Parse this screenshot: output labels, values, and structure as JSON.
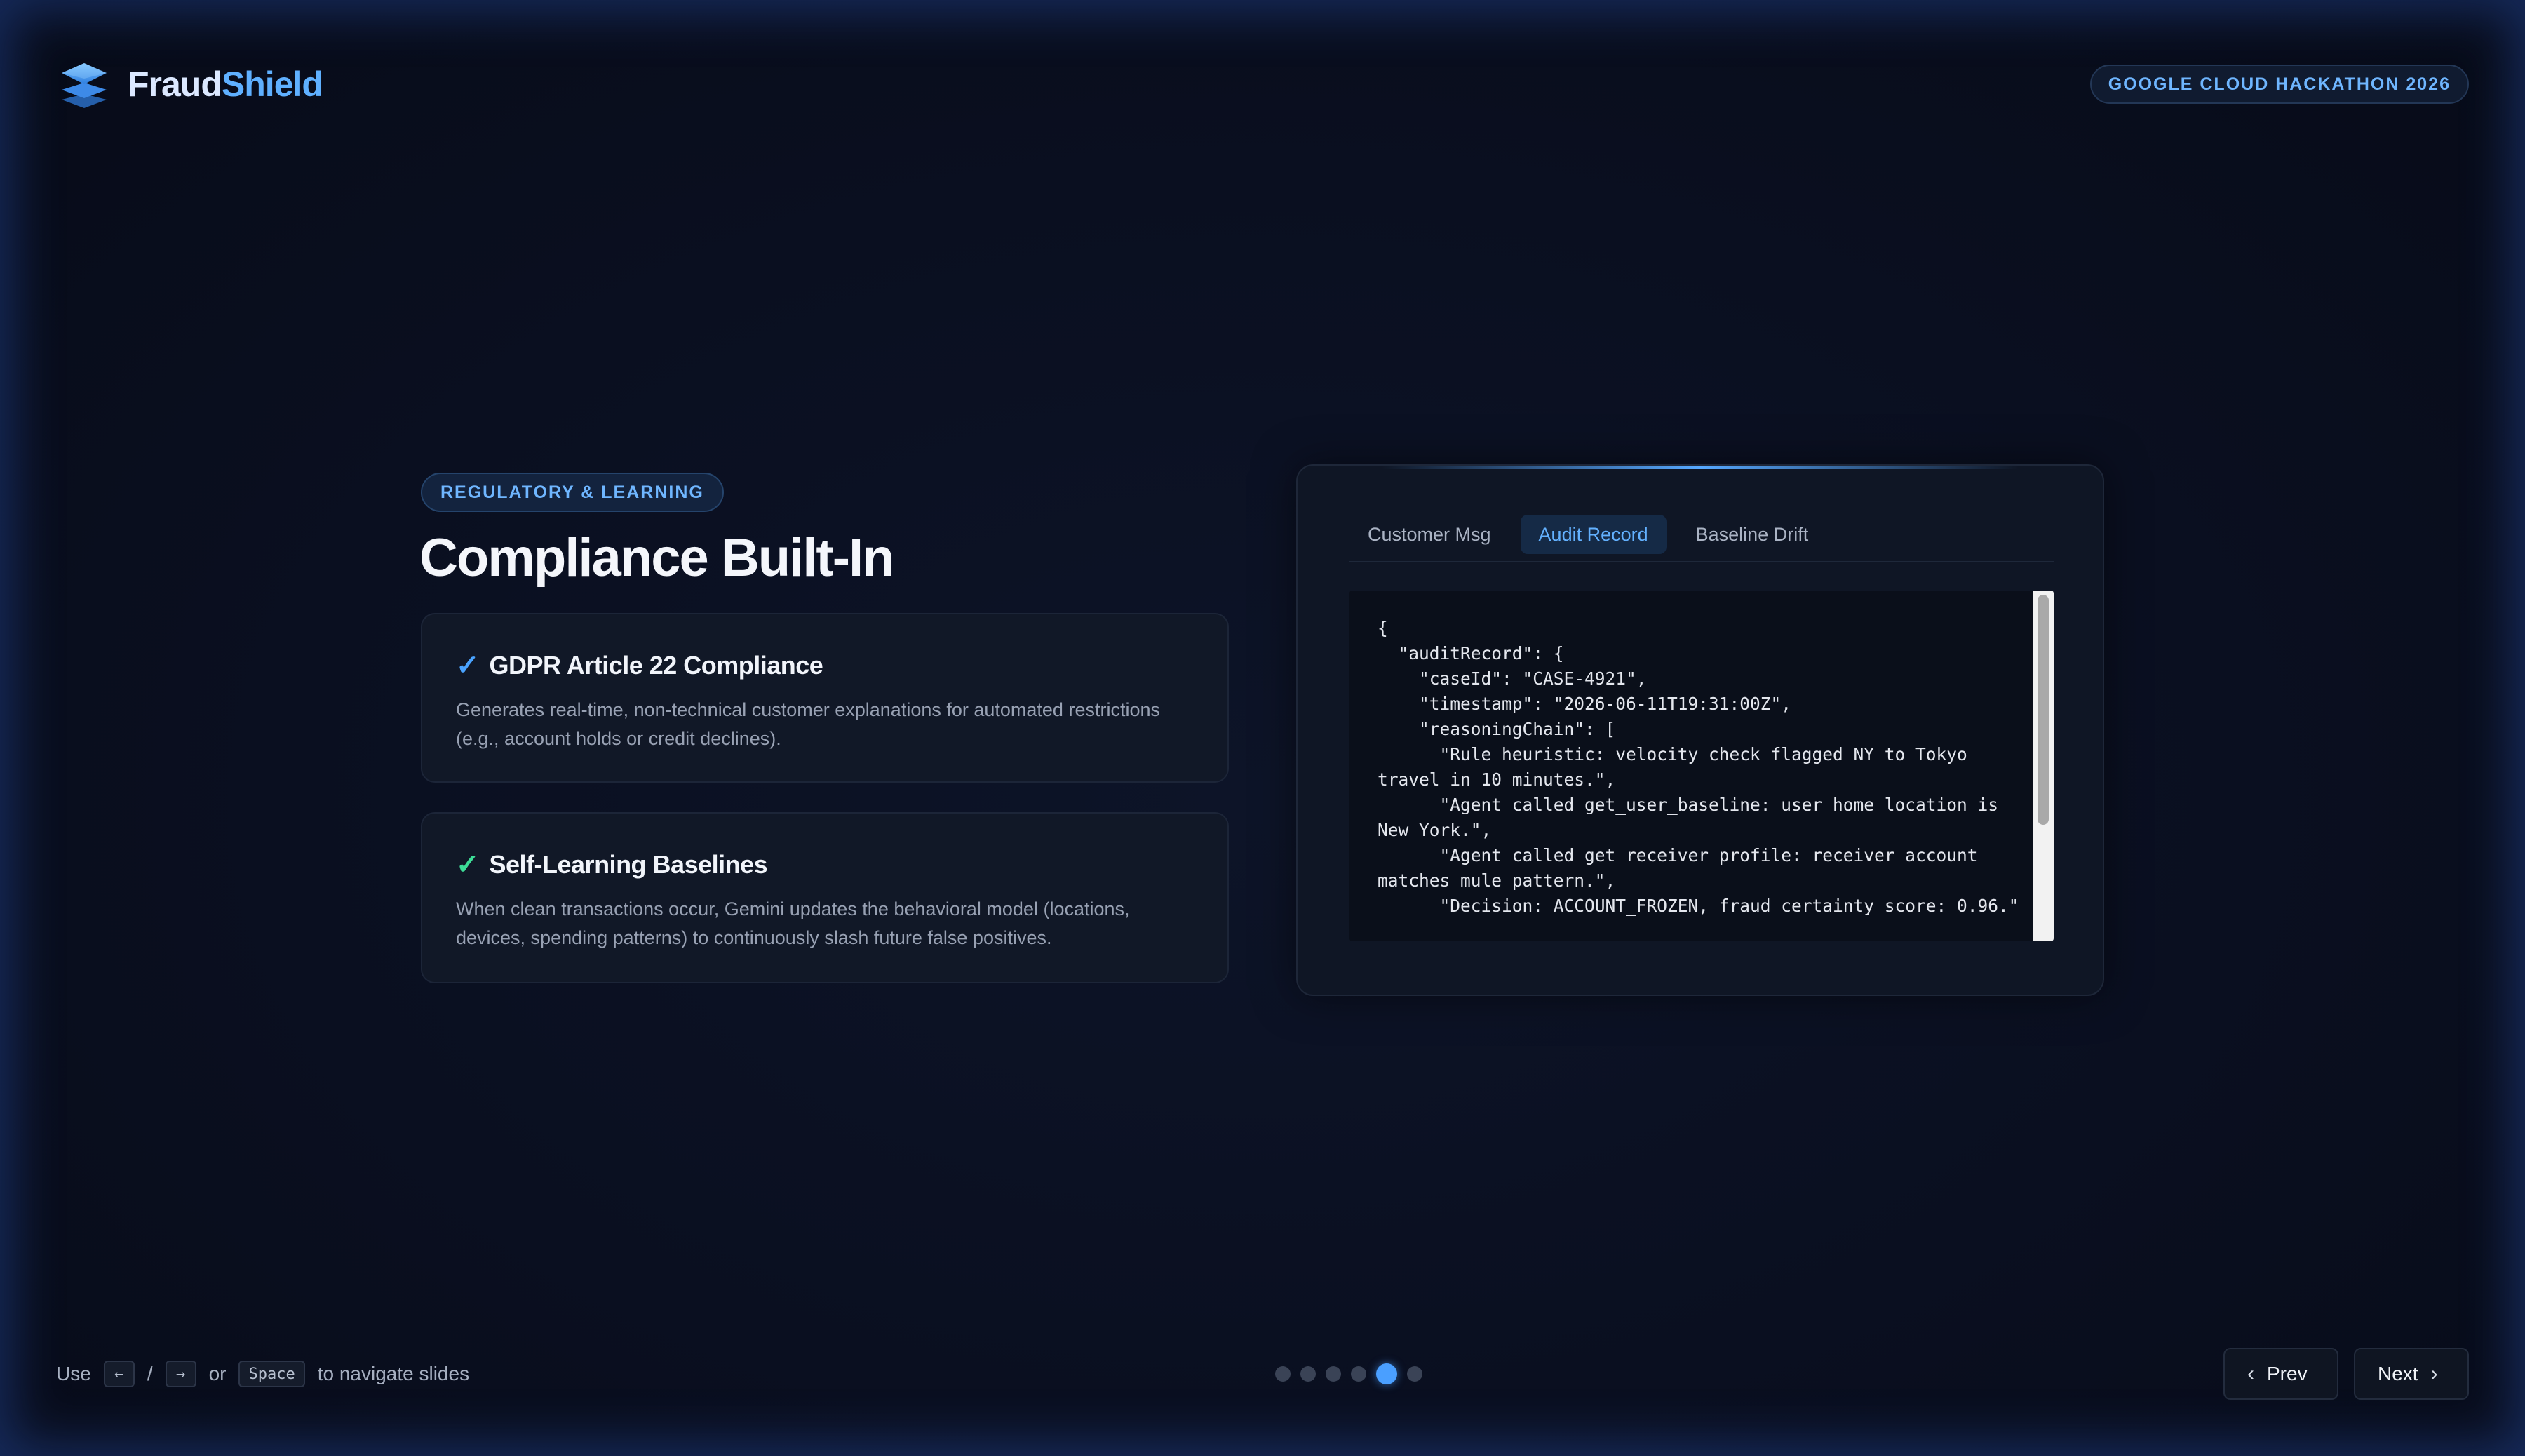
{
  "header": {
    "brand_part1": "Fraud",
    "brand_part2": "Shield",
    "badge": "GOOGLE CLOUD HACKATHON 2026"
  },
  "slide": {
    "tag": "REGULATORY & LEARNING",
    "title": "Compliance Built-In",
    "cards": [
      {
        "check": "✓",
        "title": "GDPR Article 22 Compliance",
        "description": "Generates real-time, non-technical customer explanations for automated restrictions (e.g., account holds or credit declines)."
      },
      {
        "check": "✓",
        "title": "Self-Learning Baselines",
        "description": "When clean transactions occur, Gemini updates the behavioral model (locations, devices, spending patterns) to continuously slash future false positives."
      }
    ]
  },
  "panel": {
    "tabs": [
      {
        "label": "Customer Msg",
        "active": false
      },
      {
        "label": "Audit Record",
        "active": true
      },
      {
        "label": "Baseline Drift",
        "active": false
      }
    ],
    "code": "{\n  \"auditRecord\": {\n    \"caseId\": \"CASE-4921\",\n    \"timestamp\": \"2026-06-11T19:31:00Z\",\n    \"reasoningChain\": [\n      \"Rule heuristic: velocity check flagged NY to Tokyo travel in 10 minutes.\",\n      \"Agent called get_user_baseline: user home location is New York.\",\n      \"Agent called get_receiver_profile: receiver account matches mule pattern.\",\n      \"Decision: ACCOUNT_FROZEN, fraud certainty score: 0.96.\""
  },
  "footer": {
    "hint_use": "Use",
    "key_left": "←",
    "separator": "/",
    "key_right": "→",
    "hint_or": "or",
    "key_space": "Space",
    "hint_tail": "to navigate slides",
    "slide_count": 6,
    "current_slide": 5,
    "prev_label": "Prev",
    "next_label": "Next"
  },
  "colors": {
    "accent": "#4aa3ff",
    "success": "#3ddc97",
    "background": "#0a0e1c"
  },
  "icons": {
    "brand": "layers-icon",
    "prev": "chevron-left-icon",
    "next": "chevron-right-icon"
  }
}
